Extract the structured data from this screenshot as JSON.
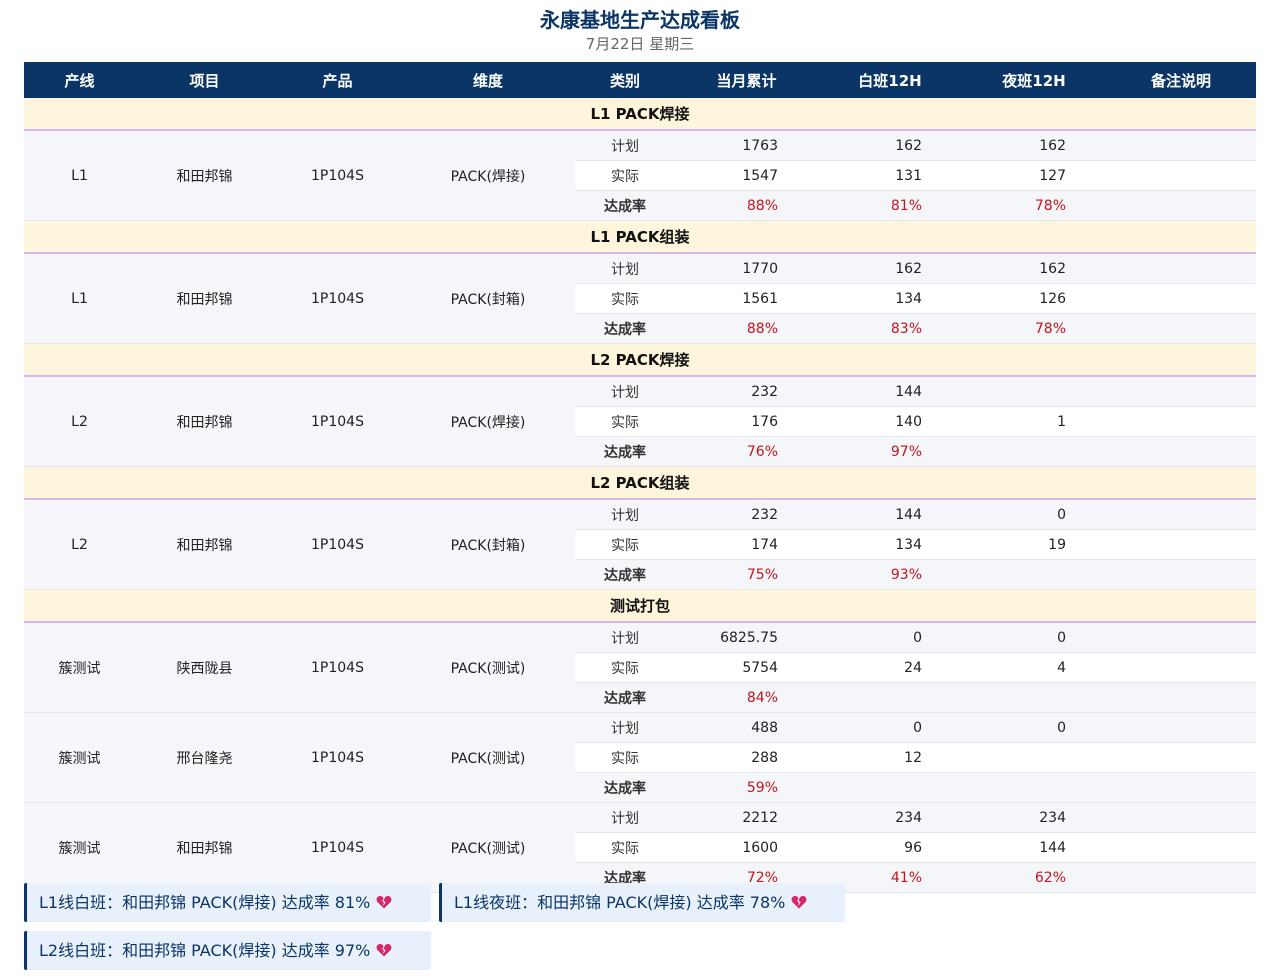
{
  "header": {
    "title": "永康基地生产达成看板",
    "subtitle": "7月22日 星期三"
  },
  "columns": [
    "产线",
    "项目",
    "产品",
    "维度",
    "类别",
    "当月累计",
    "白班12H",
    "夜班12H",
    "备注说明"
  ],
  "sections": [
    {
      "title": "L1 PACK焊接",
      "groups": [
        {
          "line": "L1",
          "project": "和田邦锦",
          "product": "1P104S",
          "dimension": "PACK(焊接)",
          "rows": [
            {
              "category": "计划",
              "month": "1763",
              "day": "162",
              "night": "162"
            },
            {
              "category": "实际",
              "month": "1547",
              "day": "131",
              "night": "127"
            },
            {
              "category": "达成率",
              "month": "88%",
              "day": "81%",
              "night": "78%"
            }
          ]
        }
      ]
    },
    {
      "title": "L1 PACK组装",
      "groups": [
        {
          "line": "L1",
          "project": "和田邦锦",
          "product": "1P104S",
          "dimension": "PACK(封箱)",
          "rows": [
            {
              "category": "计划",
              "month": "1770",
              "day": "162",
              "night": "162"
            },
            {
              "category": "实际",
              "month": "1561",
              "day": "134",
              "night": "126"
            },
            {
              "category": "达成率",
              "month": "88%",
              "day": "83%",
              "night": "78%"
            }
          ]
        }
      ]
    },
    {
      "title": "L2 PACK焊接",
      "groups": [
        {
          "line": "L2",
          "project": "和田邦锦",
          "product": "1P104S",
          "dimension": "PACK(焊接)",
          "rows": [
            {
              "category": "计划",
              "month": "232",
              "day": "144",
              "night": ""
            },
            {
              "category": "实际",
              "month": "176",
              "day": "140",
              "night": "1"
            },
            {
              "category": "达成率",
              "month": "76%",
              "day": "97%",
              "night": ""
            }
          ]
        }
      ]
    },
    {
      "title": "L2 PACK组装",
      "groups": [
        {
          "line": "L2",
          "project": "和田邦锦",
          "product": "1P104S",
          "dimension": "PACK(封箱)",
          "rows": [
            {
              "category": "计划",
              "month": "232",
              "day": "144",
              "night": "0"
            },
            {
              "category": "实际",
              "month": "174",
              "day": "134",
              "night": "19"
            },
            {
              "category": "达成率",
              "month": "75%",
              "day": "93%",
              "night": ""
            }
          ]
        }
      ]
    },
    {
      "title": "测试打包",
      "groups": [
        {
          "line": "簇测试",
          "project": "陕西陇县",
          "product": "1P104S",
          "dimension": "PACK(测试)",
          "rows": [
            {
              "category": "计划",
              "month": "6825.75",
              "day": "0",
              "night": "0"
            },
            {
              "category": "实际",
              "month": "5754",
              "day": "24",
              "night": "4"
            },
            {
              "category": "达成率",
              "month": "84%",
              "day": "",
              "night": ""
            }
          ]
        },
        {
          "line": "簇测试",
          "project": "邢台隆尧",
          "product": "1P104S",
          "dimension": "PACK(测试)",
          "rows": [
            {
              "category": "计划",
              "month": "488",
              "day": "0",
              "night": "0"
            },
            {
              "category": "实际",
              "month": "288",
              "day": "12",
              "night": ""
            },
            {
              "category": "达成率",
              "month": "59%",
              "day": "",
              "night": ""
            }
          ]
        },
        {
          "line": "簇测试",
          "project": "和田邦锦",
          "product": "1P104S",
          "dimension": "PACK(测试)",
          "rows": [
            {
              "category": "计划",
              "month": "2212",
              "day": "234",
              "night": "234"
            },
            {
              "category": "实际",
              "month": "1600",
              "day": "96",
              "night": "144"
            },
            {
              "category": "达成率",
              "month": "72%",
              "day": "41%",
              "night": "62%"
            }
          ]
        }
      ]
    }
  ],
  "alerts": [
    {
      "text": "L1线白班：和田邦锦 PACK(焊接) 达成率 81%",
      "icon": "broken-heart-icon"
    },
    {
      "text": "L1线夜班：和田邦锦 PACK(焊接) 达成率 78%",
      "icon": "broken-heart-icon"
    },
    {
      "text": "L2线白班：和田邦锦 PACK(焊接) 达成率 97%",
      "icon": "broken-heart-icon"
    }
  ],
  "colors": {
    "header_bg": "#0b3566",
    "section_bg": "#fdf6dc",
    "rate_text": "#c0161c",
    "alert_bg": "#e8f1fb"
  }
}
